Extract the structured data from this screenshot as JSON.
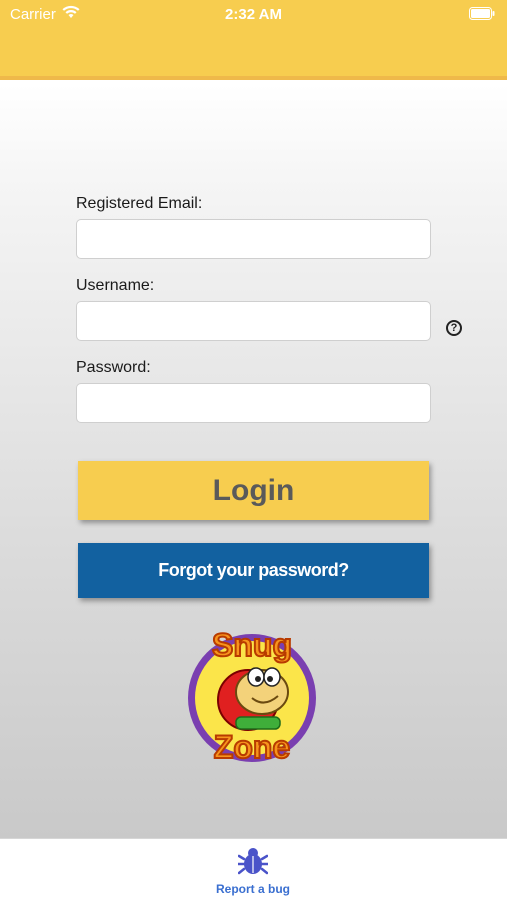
{
  "status_bar": {
    "carrier": "Carrier",
    "time": "2:32 AM"
  },
  "form": {
    "email_label": "Registered Email:",
    "email_value": "",
    "username_label": "Username:",
    "username_value": "",
    "help_symbol": "?",
    "password_label": "Password:",
    "password_value": ""
  },
  "buttons": {
    "login_label": "Login",
    "forgot_label": "Forgot your password?"
  },
  "logo": {
    "text_top": "Snug",
    "text_bottom": "Zone"
  },
  "tab_bar": {
    "report_bug_label": "Report a bug",
    "icon": "bug-icon"
  },
  "colors": {
    "accent_yellow": "#f7cd4f",
    "forgot_blue": "#1261a0",
    "tab_blue": "#3a6fd0"
  }
}
